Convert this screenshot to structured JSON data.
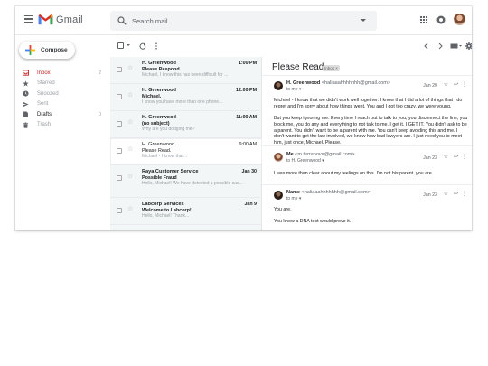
{
  "header": {
    "app_name": "Gmail",
    "search_placeholder": "Search mail",
    "icons": [
      "menu-icon",
      "search-icon",
      "apps-icon",
      "account-circle-icon"
    ]
  },
  "sidebar": {
    "compose_label": "Compose",
    "items": [
      {
        "label": "Inbox",
        "count": "2",
        "icon": "inbox-icon"
      },
      {
        "label": "Starred",
        "count": "",
        "icon": "star-icon"
      },
      {
        "label": "Snoozed",
        "count": "",
        "icon": "clock-icon"
      },
      {
        "label": "Sent",
        "count": "",
        "icon": "send-icon"
      },
      {
        "label": "Drafts",
        "count": "0",
        "icon": "draft-icon"
      },
      {
        "label": "Trash",
        "count": "",
        "icon": "trash-icon"
      }
    ]
  },
  "mail_list": [
    {
      "sender": "H. Greenwood",
      "time": "1:00 PM",
      "subject": "Please Respond.",
      "snippet": "Michael, I know this has been difficult for ..."
    },
    {
      "sender": "H. Greenwood",
      "time": "12:00 PM",
      "subject": "Michael.",
      "snippet": "I know you have more than one phone..."
    },
    {
      "sender": "H. Greenwood",
      "time": "11:00 AM",
      "subject": "(no subject)",
      "snippet": "Why are you dodging me?"
    },
    {
      "sender": "H. Greenwood",
      "time": "9:00 AM",
      "subject": "Please Read.",
      "snippet": "Michael - I know that..."
    },
    {
      "sender": "Raya Customer Service",
      "time": "Jan 30",
      "subject": "Possible Fraud",
      "snippet": "Hello, Michael! We have detected a possible cas..."
    },
    {
      "sender": "Labcorp Services",
      "time": "Jan 9",
      "subject": "Welcome to Labcorp!",
      "snippet": "Hello, Michael! Thank..."
    }
  ],
  "reading_pane": {
    "title": "Please Read.",
    "badge": "Inbox ×",
    "messages": [
      {
        "from_name": "H. Greenwood",
        "from_addr": "<haliaaahhhhhhh@gmail.com>",
        "to": "to me ▾",
        "date": "Jan 20",
        "body": "Michael - I know that we didn't work well together. I know that I did a lot of things that I do regret and I'm sorry about how things went. You and I got too crazy, we were young.\n\nBut you keep ignoring me. Every time I reach out to talk to you, you disconnect the line, you block me, you do any and everything to not talk to me. I get it. I GET IT. You didn't ask to be a parent. You didn't want to be a parent with me. You can't keep avoiding this and me. I don't want to get the law involved, we know how bad lawyers are. I just need you to meet him, just once, Michael. Please."
      },
      {
        "from_name": "Me",
        "from_addr": "<m.terranova@gmail.com>",
        "to": "to H. Greenwood ▾",
        "date": "Jan 23",
        "body": "I was more than clear about my feelings on this. I'm not his parent. you are."
      },
      {
        "from_name": "Name",
        "from_addr": "<haliaaahhhhhhh@gmail.com>",
        "to": "to me ▾",
        "date": "Jan 23",
        "body": "You are.\n\nYou know a DNA test would prove it."
      }
    ]
  },
  "colors": {
    "gmail_red": "#d93025",
    "list_bg": "#f2f6f6",
    "text": "#202124",
    "muted": "#9aa0a6"
  }
}
